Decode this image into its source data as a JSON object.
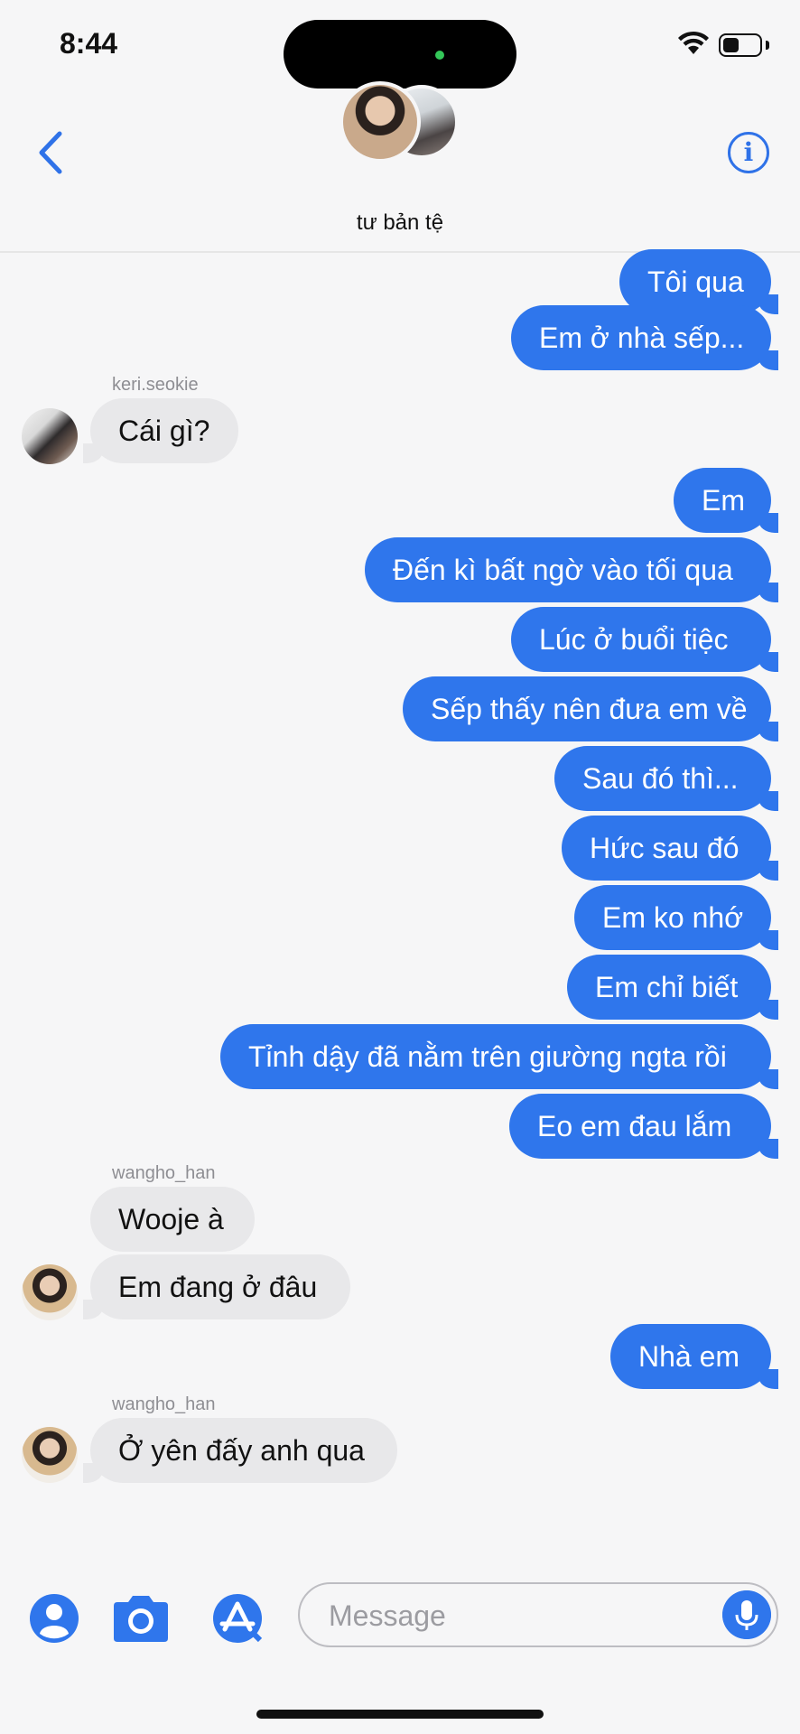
{
  "status_bar": {
    "time": "8:44",
    "battery_level": 0.45
  },
  "header": {
    "group_name": "tư bản tệ"
  },
  "messages": [
    {
      "sender": "me",
      "text": "Tôi qua"
    },
    {
      "sender": "me",
      "text": "Em ở nhà sếp..."
    },
    {
      "sender": "keri.seokie",
      "text": "Cái gì?"
    },
    {
      "sender": "me",
      "text": "Em"
    },
    {
      "sender": "me",
      "text": "Đến kì bất ngờ vào tối qua"
    },
    {
      "sender": "me",
      "text": "Lúc ở buổi tiệc"
    },
    {
      "sender": "me",
      "text": "Sếp thấy nên đưa em về"
    },
    {
      "sender": "me",
      "text": "Sau đó thì..."
    },
    {
      "sender": "me",
      "text": "Hức sau đó"
    },
    {
      "sender": "me",
      "text": "Em ko nhớ"
    },
    {
      "sender": "me",
      "text": "Em chỉ biết"
    },
    {
      "sender": "me",
      "text": "Tỉnh dậy đã nằm trên giường ngta rồi"
    },
    {
      "sender": "me",
      "text": "Eo em đau lắm"
    },
    {
      "sender": "wangho_han",
      "text": "Wooje à"
    },
    {
      "sender": "wangho_han",
      "text": "Em đang ở đâu"
    },
    {
      "sender": "me",
      "text": "Nhà em"
    },
    {
      "sender": "wangho_han",
      "text": "Ở yên đấy anh qua"
    }
  ],
  "sender_labels": {
    "keri": "keri.seokie",
    "wangho1": "wangho_han",
    "wangho2": "wangho_han"
  },
  "input": {
    "placeholder": "Message"
  },
  "colors": {
    "accent": "#2f76ec",
    "incoming_bubble": "#e8e8ea",
    "background": "#f6f6f7"
  },
  "icons": [
    "back-chevron-icon",
    "info-icon",
    "contact-icon",
    "camera-icon",
    "app-store-icon",
    "microphone-icon",
    "wifi-icon",
    "battery-icon"
  ]
}
